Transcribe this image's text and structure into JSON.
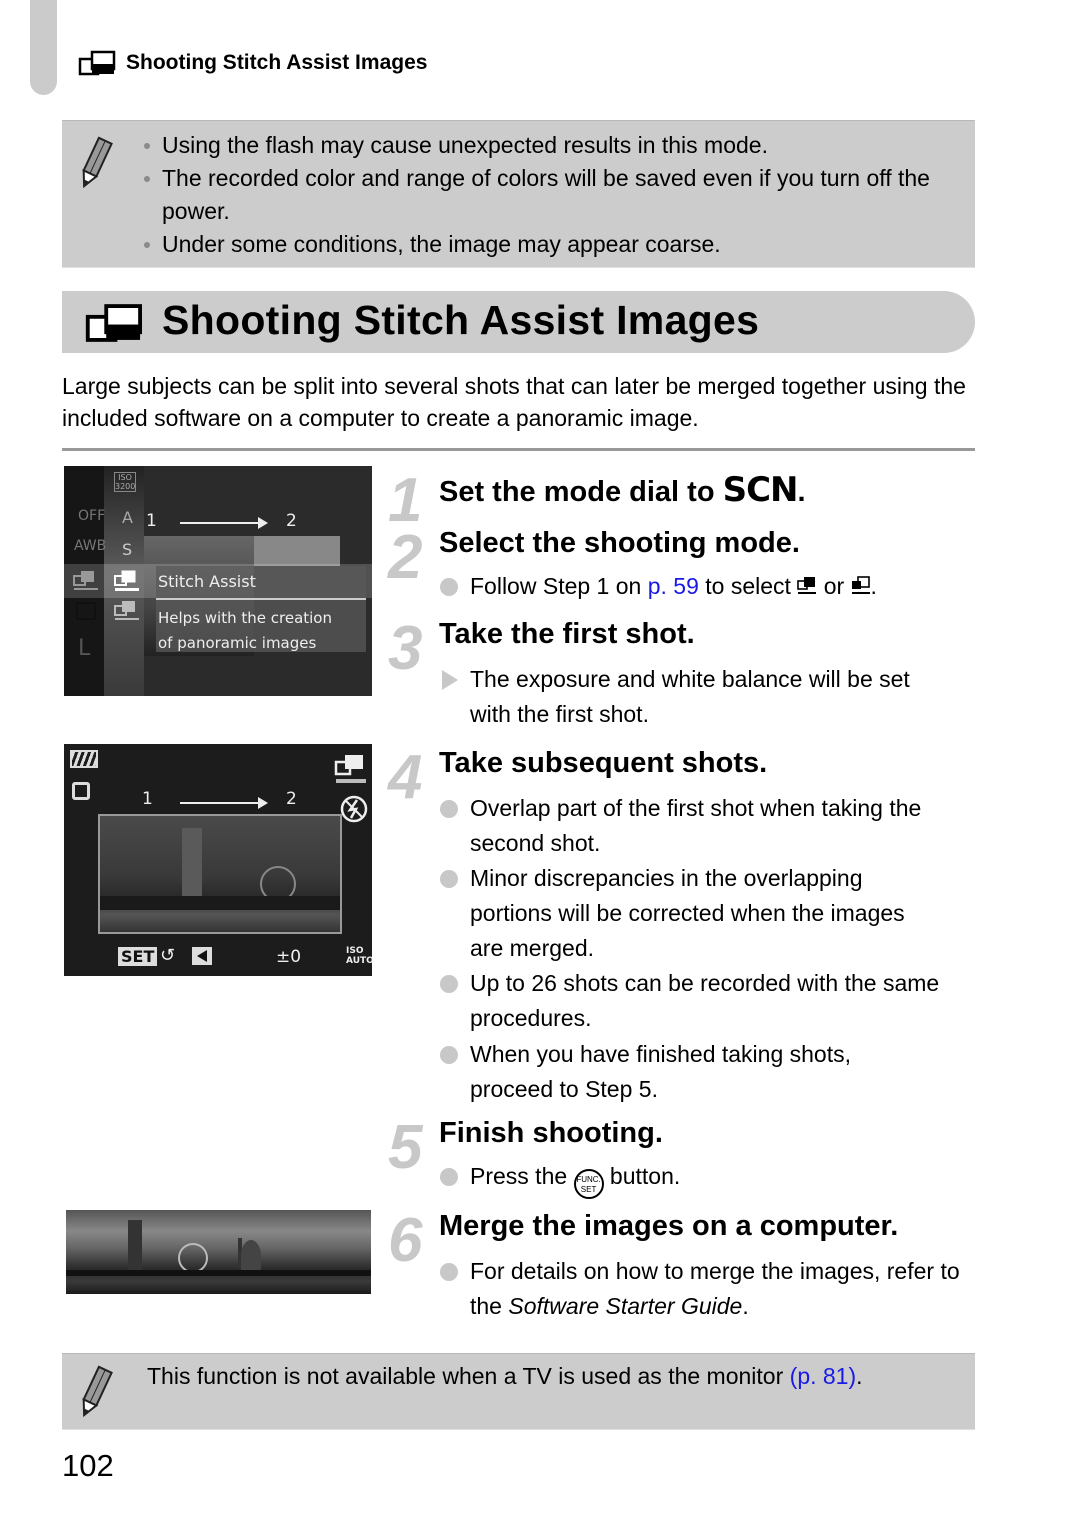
{
  "running_head": {
    "icon": "stitch-assist-icon",
    "title": "Shooting Stitch Assist Images"
  },
  "top_note": {
    "icon": "pencil-icon",
    "items": [
      "Using the flash may cause unexpected results in this mode.",
      "The recorded color and range of colors will be saved even if you turn off the power.",
      "Under some conditions, the image may appear coarse."
    ]
  },
  "section": {
    "icon": "stitch-assist-icon",
    "title": "Shooting Stitch Assist Images",
    "intro": "Large subjects can be split into several shots that can later be merged together using the included software on a computer to create a panoramic image."
  },
  "screens": {
    "menu": {
      "left_column": [
        "OFF",
        "AWB",
        "",
        "",
        "L"
      ],
      "iso_label": "ISO 3200",
      "items": [
        "A",
        "S"
      ],
      "arrow_from": "1",
      "arrow_to": "2",
      "option_title": "Stitch Assist",
      "option_desc_1": "Helps with the creation",
      "option_desc_2": "of panoramic images"
    },
    "live": {
      "arrow_from": "1",
      "arrow_to": "2",
      "set_label": "SET",
      "exposure": "±0",
      "iso_top": "ISO",
      "iso_bottom": "AUTO"
    }
  },
  "steps": [
    {
      "num": "1",
      "title_prefix": "Set the mode dial to ",
      "title_mode": "SCN",
      "title_suffix": "."
    },
    {
      "num": "2",
      "title": "Select the shooting mode.",
      "bullets": [
        {
          "pre": "Follow Step 1 on ",
          "link": "p. 59",
          "post": " to select ",
          "mid": " or ",
          "end": "."
        }
      ]
    },
    {
      "num": "3",
      "title": "Take the first shot.",
      "bullets": [
        {
          "text": "The exposure and white balance will be set with the first shot.",
          "marker": "triangle"
        }
      ]
    },
    {
      "num": "4",
      "title": "Take subsequent shots.",
      "bullets": [
        {
          "text": "Overlap part of the first shot when taking the second shot."
        },
        {
          "text": "Minor discrepancies in the overlapping portions will be corrected when the images are merged."
        },
        {
          "text": "Up to 26 shots can be recorded with the same procedures."
        },
        {
          "text": "When you have finished taking shots, proceed to Step 5."
        }
      ]
    },
    {
      "num": "5",
      "title": "Finish shooting.",
      "bullets": [
        {
          "pre": "Press the ",
          "button_top": "FUNC.",
          "button_bottom": "SET",
          "post": " button."
        }
      ]
    },
    {
      "num": "6",
      "title": "Merge the images on a computer.",
      "bullets": [
        {
          "pre": "For details on how to merge the images, refer to the ",
          "italic": "Software Starter Guide",
          "post": "."
        }
      ]
    }
  ],
  "bottom_note": {
    "icon": "pencil-icon",
    "text": "This function is not available when a TV is used as the monitor ",
    "link": "(p. 81)",
    "end": "."
  },
  "page_number": "102",
  "colors": {
    "note_bg": "#cccccc",
    "link": "#1a1ae6",
    "step_number": "#c8c8c8"
  }
}
